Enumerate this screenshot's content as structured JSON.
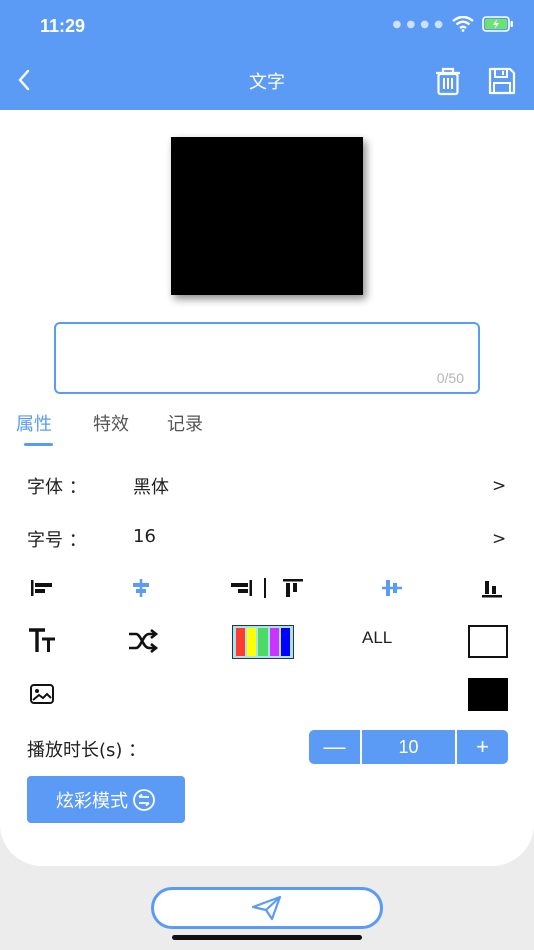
{
  "status": {
    "time": "11:29"
  },
  "nav": {
    "title": "文字"
  },
  "text_input": {
    "value": "",
    "counter": "0/50"
  },
  "tabs": [
    {
      "label": "属性"
    },
    {
      "label": "特效"
    },
    {
      "label": "记录"
    }
  ],
  "font": {
    "label": "字体 ：",
    "value": "黑体",
    "arrow": ">"
  },
  "size": {
    "label": "字号 ：",
    "value": "16",
    "arrow": ">"
  },
  "toolbar": {
    "all_label": "ALL"
  },
  "duration": {
    "label": "播放时长(s) ：",
    "minus": "—",
    "value": "10",
    "plus": "+"
  },
  "mode_button": {
    "label": "炫彩模式"
  },
  "colors": {
    "accent": "#5b9bf5",
    "text_color": "#000000",
    "palette": [
      "#ff3b30",
      "#ffff00",
      "#4cd964",
      "#cc33ff",
      "#0000ff"
    ]
  }
}
